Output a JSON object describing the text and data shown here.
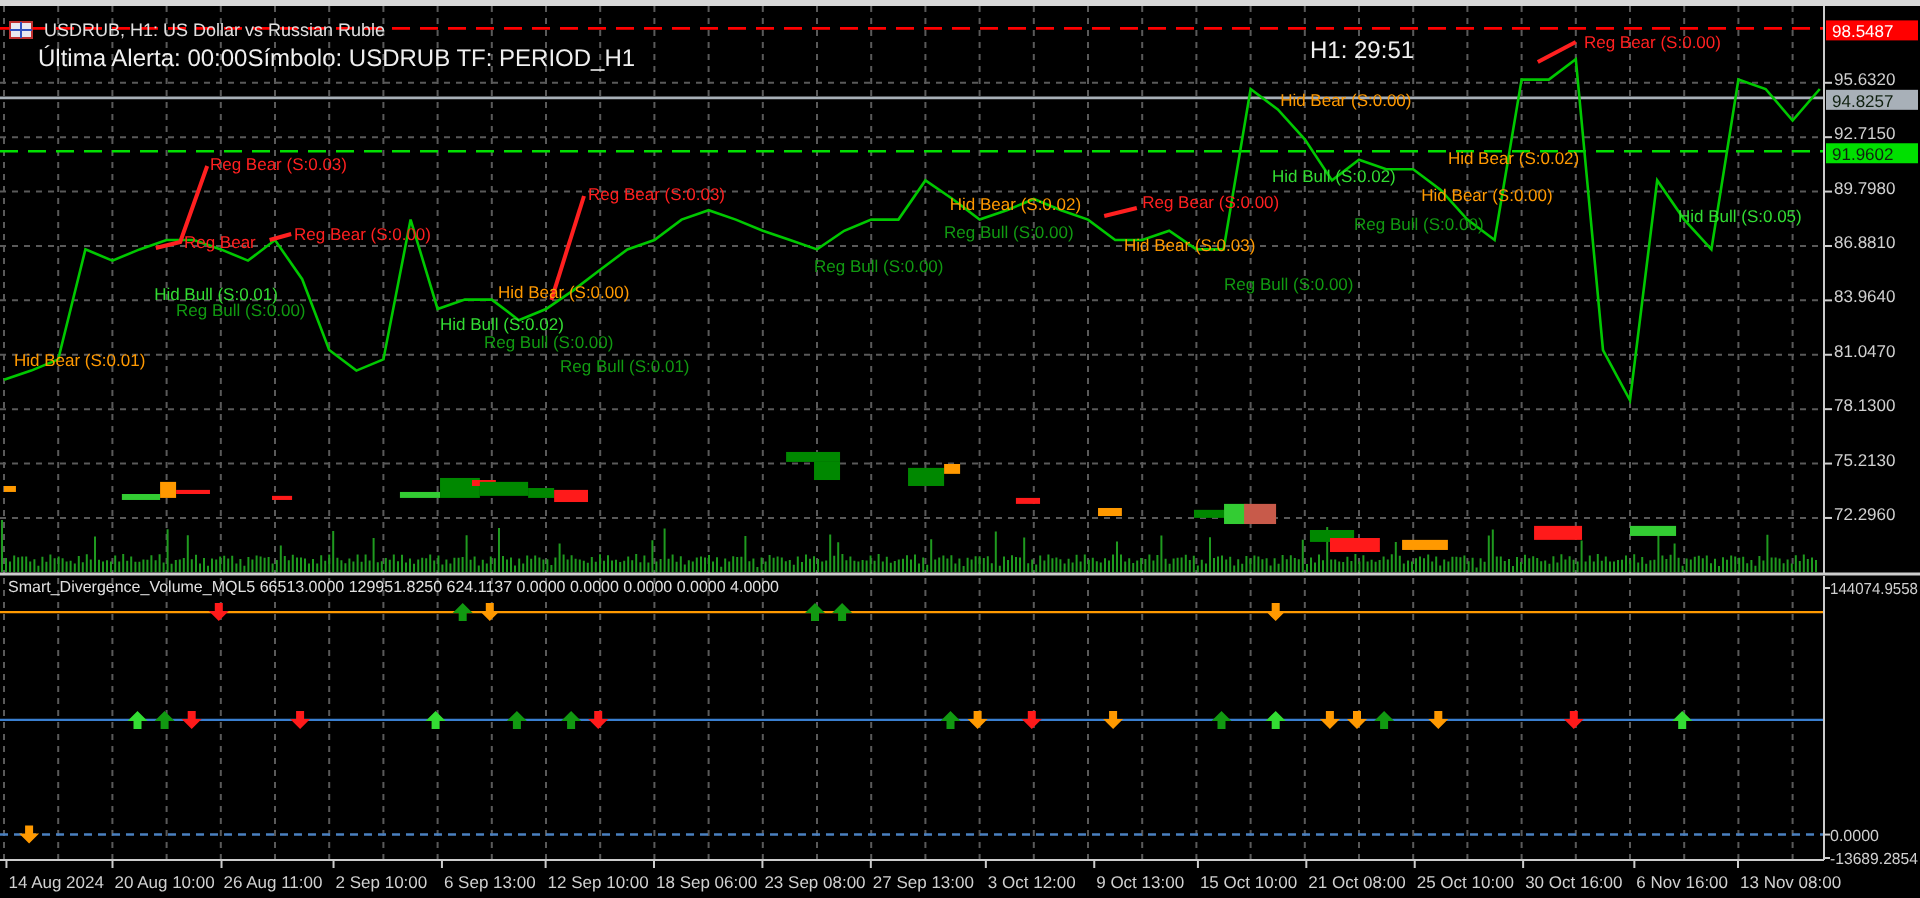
{
  "header": {
    "symbol_title": "USDRUB, H1:  US Dollar vs Russian Ruble",
    "alert_text": "Última Alerta: 00:00Símbolo: USDRUB  TF: PERIOD_H1",
    "timer": "H1: 29:51"
  },
  "price_chart": {
    "chart_data": {
      "type": "line",
      "grid": true,
      "ylim": [
        69.29,
        99.75
      ],
      "series": [
        {
          "color": "#00c800",
          "values": [
            79.7,
            80.2,
            80.8,
            86.7,
            86.1,
            86.7,
            87.2,
            87.2,
            86.7,
            86.1,
            87.2,
            85.1,
            81.3,
            80.2,
            80.8,
            88.3,
            83.5,
            84.0,
            84.0,
            82.9,
            83.5,
            84.5,
            85.6,
            86.7,
            87.2,
            88.3,
            88.8,
            88.3,
            87.7,
            87.2,
            86.7,
            87.7,
            88.3,
            88.3,
            90.4,
            89.4,
            88.3,
            88.8,
            89.4,
            88.8,
            88.3,
            87.2,
            87.2,
            87.7,
            86.7,
            86.7,
            95.3,
            94.2,
            92.6,
            90.4,
            91.5,
            91.0,
            91.0,
            89.9,
            88.3,
            87.2,
            95.8,
            95.8,
            96.9,
            81.3,
            78.6,
            90.4,
            88.3,
            86.7,
            95.8,
            95.3,
            93.6,
            95.3
          ]
        }
      ],
      "yticks": [
        {
          "value": 95.632,
          "label": "95.6320"
        },
        {
          "value": 92.715,
          "label": "92.7150"
        },
        {
          "value": 89.798,
          "label": "89.7980"
        },
        {
          "value": 86.881,
          "label": "86.8810"
        },
        {
          "value": 83.964,
          "label": "83.9640"
        },
        {
          "value": 81.047,
          "label": "81.0470"
        },
        {
          "value": 78.13,
          "label": "78.1300"
        },
        {
          "value": 75.213,
          "label": "75.2130"
        },
        {
          "value": 72.296,
          "label": "72.2960"
        }
      ],
      "ref_lines": [
        {
          "axis": "y",
          "value": 98.5487,
          "label": "98.5487",
          "color": "#ff0000"
        },
        {
          "axis": "y",
          "value": 94.8257,
          "label": "94.8257",
          "color": "#a8b0b8"
        },
        {
          "axis": "y",
          "value": 91.9602,
          "label": "91.9602",
          "color": "#00e000"
        }
      ]
    },
    "divergence_labels": [
      {
        "text": "Hid Bear  (S:0.01)",
        "color": "#ff9900"
      },
      {
        "text": "Reg Bear  (S:0.03)",
        "color": "#ff2020"
      },
      {
        "text": "Reg Bear",
        "color": "#ff2020"
      },
      {
        "text": "Reg Bear  (S:0.00)",
        "color": "#ff2020"
      },
      {
        "text": "Hid Bull  (S:0.01)",
        "color": "#33dd33"
      },
      {
        "text": "Reg Bull  (S:0.00)",
        "color": "#119911"
      },
      {
        "text": "Reg Bear  (S:0.03)",
        "color": "#ff2020"
      },
      {
        "text": "Hid Bear  (S:0.00)",
        "color": "#ff9900"
      },
      {
        "text": "Hid Bull  (S:0.02)",
        "color": "#33dd33"
      },
      {
        "text": "Reg Bull  (S:0.00)",
        "color": "#119911"
      },
      {
        "text": "Reg Bull  (S:0.01)",
        "color": "#119911"
      },
      {
        "text": "Reg Bull  (S:0.00)",
        "color": "#119911"
      },
      {
        "text": "Hid Bear  (S:0.02)",
        "color": "#ff9900"
      },
      {
        "text": "Reg Bear  (S:0.00)",
        "color": "#ff2020"
      },
      {
        "text": "Reg Bull  (S:0.00)",
        "color": "#119911"
      },
      {
        "text": "Hid Bear  (S:0.03)",
        "color": "#ff9900"
      },
      {
        "text": "Reg Bull  (S:0.00)",
        "color": "#119911"
      },
      {
        "text": "Hid Bear  (S:0.00)",
        "color": "#ff9900"
      },
      {
        "text": "Hid Bull  (S:0.02)",
        "color": "#33dd33"
      },
      {
        "text": "Hid Bear  (S:0.02)",
        "color": "#ff9900"
      },
      {
        "text": "Hid Bear  (S:0.00)",
        "color": "#ff9900"
      },
      {
        "text": "Reg Bull  (S:0.00)",
        "color": "#119911"
      },
      {
        "text": "Reg Bear  (S:0.00)",
        "color": "#ff2020"
      },
      {
        "text": "Hid Bull  (S:0.05)",
        "color": "#33dd33"
      }
    ],
    "volume_zones": [
      {
        "color": "#ff9900"
      },
      {
        "color": "#33cc33"
      },
      {
        "color": "#ff9900"
      },
      {
        "color": "#ff1a1a"
      },
      {
        "color": "#ff1a1a"
      },
      {
        "color": "#33cc33"
      },
      {
        "color": "#008800"
      },
      {
        "color": "#ff1a1a"
      },
      {
        "color": "#008800"
      },
      {
        "color": "#008800"
      },
      {
        "color": "#ff1a1a"
      },
      {
        "color": "#008800"
      },
      {
        "color": "#008800"
      },
      {
        "color": "#008800"
      },
      {
        "color": "#ff9900"
      },
      {
        "color": "#ff1a1a"
      },
      {
        "color": "#ff9900"
      },
      {
        "color": "#008800"
      },
      {
        "color": "#33cc33"
      },
      {
        "color": "#c85a4a"
      },
      {
        "color": "#008800"
      },
      {
        "color": "#ff1a1a"
      },
      {
        "color": "#ff9900"
      },
      {
        "color": "#ff1a1a"
      },
      {
        "color": "#33cc33"
      }
    ]
  },
  "indicator_chart": {
    "chart_data": {
      "type": "scatter",
      "grid": true,
      "title": "Smart_Divergence_Volume_MQL5 66513.0000 129951.8250 624.1137 0.0000 0.0000 0.0000 0.0000 4.0000",
      "ylim": [
        -13689.2854,
        144074.9558
      ],
      "yticks": [
        {
          "value": 144074.9558,
          "label": "144074.9558"
        },
        {
          "value": 0,
          "label": "0.0000"
        },
        {
          "value": -13689.2854,
          "label": "-13689.2854"
        }
      ],
      "categories": [
        null,
        null,
        "14 Aug 2024",
        null,
        null,
        null,
        "20 Aug 10:00",
        null,
        null,
        null,
        "26 Aug 11:00",
        null,
        null,
        null,
        "2 Sep 10:00",
        null,
        null,
        null,
        "6 Sep 13:00",
        null,
        null,
        null,
        "12 Sep 10:00",
        null,
        null,
        null,
        "18 Sep 06:00",
        null,
        null,
        null,
        "23 Sep 08:00",
        null,
        null,
        null,
        "27 Sep 13:00",
        null,
        null,
        null,
        "3 Oct 12:00",
        null,
        null,
        null,
        "9 Oct 13:00",
        null,
        null,
        null,
        "15 Oct 10:00",
        null,
        null,
        null,
        "21 Oct 08:00",
        null,
        null,
        null,
        "25 Oct 10:00",
        null,
        null,
        null,
        "30 Oct 16:00",
        null,
        null,
        null,
        "6 Nov 16:00",
        null,
        null,
        null,
        "13 Nov 08:00",
        null
      ],
      "ref_lines": [
        {
          "axis": "y",
          "value": 130000,
          "color": "#ff9900"
        },
        {
          "axis": "y",
          "value": 67000,
          "color": "#3a7fd0"
        },
        {
          "axis": "y",
          "value": 0,
          "color": "#4a80c0"
        }
      ],
      "series": [
        {
          "color": "#33dd33",
          "values": [
            null,
            null,
            null,
            null,
            null,
            67000,
            null,
            null,
            null,
            null,
            null,
            null,
            null,
            null,
            null,
            null,
            67000,
            null,
            null,
            null,
            null,
            null,
            null,
            null,
            null,
            null,
            null,
            null,
            null,
            null,
            null,
            null,
            null,
            null,
            null,
            null,
            null,
            null,
            null,
            null,
            null,
            null,
            null,
            null,
            null,
            null,
            null,
            67000,
            null,
            null,
            null,
            null,
            null,
            null,
            null,
            null,
            null,
            null,
            null,
            null,
            null,
            null,
            67000,
            null,
            null,
            null,
            null,
            null
          ]
        },
        {
          "color": "#119911",
          "values": [
            null,
            null,
            null,
            null,
            null,
            null,
            67000,
            null,
            null,
            null,
            null,
            null,
            null,
            null,
            null,
            null,
            null,
            130000,
            null,
            67000,
            null,
            67000,
            null,
            null,
            null,
            null,
            null,
            null,
            null,
            null,
            130000,
            130000,
            null,
            null,
            null,
            67000,
            null,
            null,
            null,
            null,
            null,
            null,
            null,
            null,
            null,
            67000,
            null,
            null,
            null,
            null,
            null,
            67000,
            null,
            null,
            null,
            null,
            null,
            null,
            null,
            null,
            null,
            null,
            null,
            null,
            null,
            null,
            null,
            null
          ]
        },
        {
          "color": "#ff1a1a",
          "values": [
            null,
            null,
            null,
            null,
            null,
            null,
            null,
            67000,
            130000,
            null,
            null,
            67000,
            null,
            null,
            null,
            null,
            null,
            null,
            null,
            null,
            null,
            null,
            67000,
            null,
            null,
            null,
            null,
            null,
            null,
            null,
            null,
            null,
            null,
            null,
            null,
            null,
            null,
            null,
            67000,
            null,
            null,
            null,
            null,
            null,
            null,
            null,
            null,
            null,
            null,
            null,
            null,
            null,
            null,
            null,
            null,
            null,
            null,
            null,
            67000,
            null,
            null,
            null,
            null,
            null,
            null,
            null,
            null,
            null
          ]
        },
        {
          "color": "#ff9900",
          "values": [
            null,
            0,
            null,
            null,
            null,
            null,
            null,
            null,
            null,
            null,
            null,
            null,
            null,
            null,
            null,
            null,
            null,
            null,
            130000,
            null,
            null,
            null,
            null,
            null,
            null,
            null,
            null,
            null,
            null,
            null,
            null,
            null,
            null,
            null,
            null,
            null,
            67000,
            null,
            null,
            null,
            null,
            67000,
            null,
            null,
            null,
            null,
            null,
            130000,
            null,
            67000,
            67000,
            null,
            null,
            67000,
            null,
            null,
            null,
            null,
            null,
            null,
            null,
            null,
            null,
            null,
            null,
            null,
            null,
            null
          ]
        }
      ]
    }
  }
}
